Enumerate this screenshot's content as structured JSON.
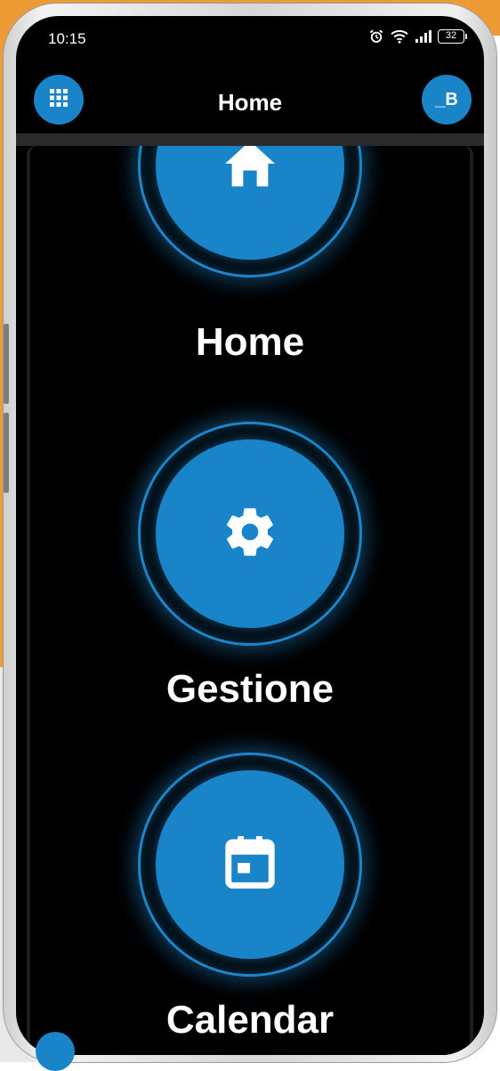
{
  "status_bar": {
    "time": "10:15",
    "battery": "32",
    "icons": [
      "alarm-icon",
      "wifi-icon",
      "signal-icon",
      "battery-icon"
    ]
  },
  "app_bar": {
    "title": "Home",
    "menu_icon": "apps-grid-icon",
    "user_initials": "_B"
  },
  "tiles": [
    {
      "label": "Home",
      "icon": "home-icon"
    },
    {
      "label": "Gestione",
      "icon": "gear-icon"
    },
    {
      "label": "Calendar",
      "icon": "calendar-icon"
    }
  ],
  "colors": {
    "accent": "#1a84c8",
    "background": "#000000",
    "text": "#ffffff",
    "page_backdrop": "#ee9a35"
  }
}
